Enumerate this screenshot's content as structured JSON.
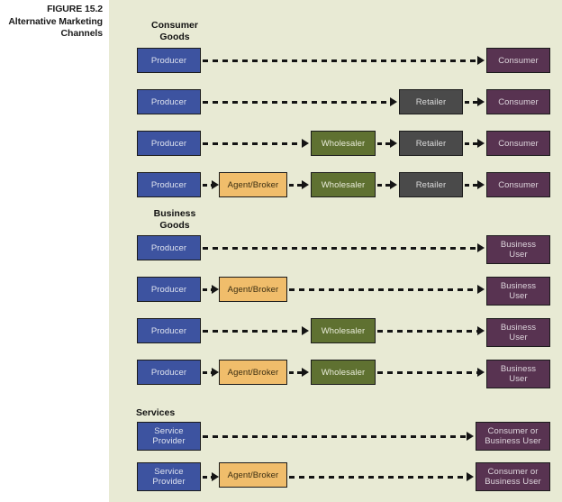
{
  "figure": {
    "number_label": "FIGURE 15.2",
    "title_line1": "Alternative Marketing",
    "title_line2": "Channels"
  },
  "sections": [
    {
      "id": "consumer-goods",
      "title_line1": "Consumer",
      "title_line2": "Goods"
    },
    {
      "id": "business-goods",
      "title_line1": "Business",
      "title_line2": "Goods"
    },
    {
      "id": "services",
      "title_line1": "Services",
      "title_line2": ""
    }
  ],
  "node_labels": {
    "producer": "Producer",
    "service_provider_line1": "Service",
    "service_provider_line2": "Provider",
    "agent_broker": "Agent/Broker",
    "wholesaler": "Wholesaler",
    "retailer": "Retailer",
    "consumer": "Consumer",
    "business_user_line1": "Business",
    "business_user_line2": "User",
    "consumer_or_line1": "Consumer or",
    "consumer_or_line2": "Business User"
  },
  "colors": {
    "panel_background": "#e8ead4",
    "producer": "#3d53a0",
    "agent_broker": "#f0bd6b",
    "wholesaler": "#5f7131",
    "retailer": "#4a4a4a",
    "consumer": "#583351",
    "business_user": "#583351",
    "connector": "#141414",
    "page_background": "#ffffff"
  },
  "channels": [
    {
      "section": "consumer-goods",
      "row": 1,
      "nodes": [
        "producer",
        "consumer"
      ]
    },
    {
      "section": "consumer-goods",
      "row": 2,
      "nodes": [
        "producer",
        "retailer",
        "consumer"
      ]
    },
    {
      "section": "consumer-goods",
      "row": 3,
      "nodes": [
        "producer",
        "wholesaler",
        "retailer",
        "consumer"
      ]
    },
    {
      "section": "consumer-goods",
      "row": 4,
      "nodes": [
        "producer",
        "agent_broker",
        "wholesaler",
        "retailer",
        "consumer"
      ]
    },
    {
      "section": "business-goods",
      "row": 1,
      "nodes": [
        "producer",
        "business_user"
      ]
    },
    {
      "section": "business-goods",
      "row": 2,
      "nodes": [
        "producer",
        "agent_broker",
        "business_user"
      ]
    },
    {
      "section": "business-goods",
      "row": 3,
      "nodes": [
        "producer",
        "wholesaler",
        "business_user"
      ]
    },
    {
      "section": "business-goods",
      "row": 4,
      "nodes": [
        "producer",
        "agent_broker",
        "wholesaler",
        "business_user"
      ]
    },
    {
      "section": "services",
      "row": 1,
      "nodes": [
        "service_provider",
        "consumer_or_business_user"
      ]
    },
    {
      "section": "services",
      "row": 2,
      "nodes": [
        "service_provider",
        "agent_broker",
        "consumer_or_business_user"
      ]
    }
  ]
}
